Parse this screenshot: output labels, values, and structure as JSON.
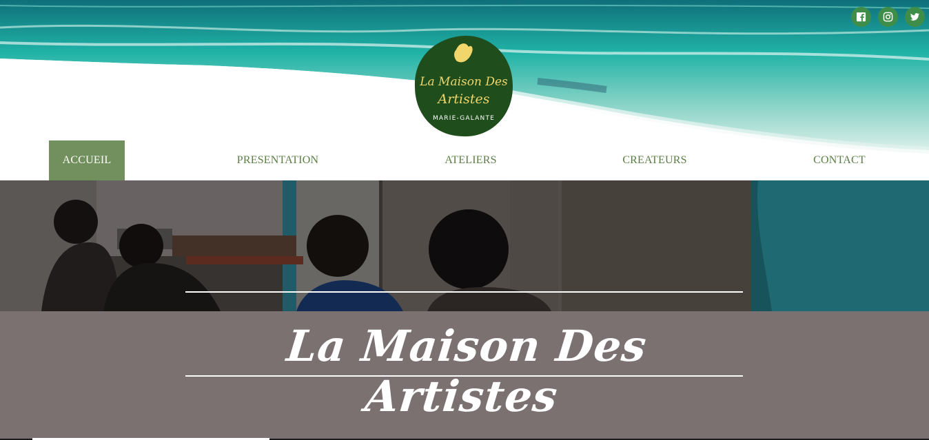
{
  "site": {
    "logo": {
      "line1": "La Maison Des",
      "line2": "Artistes",
      "line3": "MARIE-GALANTE"
    }
  },
  "social": [
    {
      "name": "facebook-icon"
    },
    {
      "name": "instagram-icon"
    },
    {
      "name": "twitter-icon"
    }
  ],
  "nav": {
    "items": [
      {
        "label": "ACCUEIL",
        "active": true
      },
      {
        "label": "PRESENTATION",
        "active": false
      },
      {
        "label": "ATELIERS",
        "active": false
      },
      {
        "label": "CREATEURS",
        "active": false
      },
      {
        "label": "CONTACT",
        "active": false
      }
    ]
  },
  "hero": {
    "title": "La Maison Des Artistes"
  },
  "colors": {
    "brand_green": "#1f4d1c",
    "nav_text": "#5b7d45",
    "nav_active_bg": "#72905d",
    "hero_bg": "#7b7171",
    "logo_text": "#f1d66b"
  }
}
